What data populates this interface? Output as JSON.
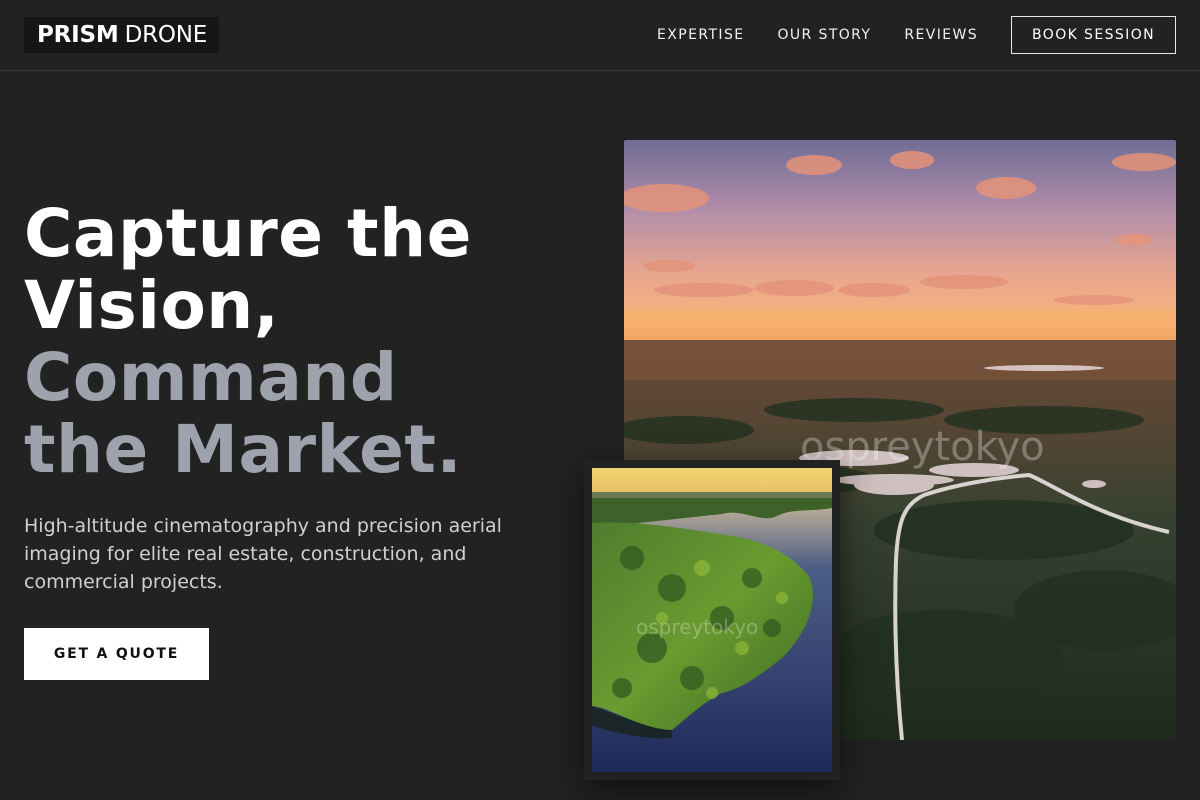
{
  "header": {
    "logo_bold": "PRISM",
    "logo_light": "DRONE",
    "nav": [
      {
        "label": "EXPERTISE"
      },
      {
        "label": "OUR STORY"
      },
      {
        "label": "REVIEWS"
      }
    ],
    "cta_label": "BOOK SESSION"
  },
  "hero": {
    "headline": {
      "line1": "Capture the",
      "line2": "Vision,",
      "line3": "Command",
      "line4": "the Market."
    },
    "subtext": "High-altitude cinematography and precision aerial imaging for elite real estate, construction, and commercial projects.",
    "cta_label": "GET A QUOTE"
  },
  "images": {
    "main_watermark": "ospreytokyo",
    "small_watermark": "ospreytokyo"
  },
  "colors": {
    "background": "#222222",
    "headline_accent": "#9ea2ad",
    "button_bg": "#ffffff"
  }
}
